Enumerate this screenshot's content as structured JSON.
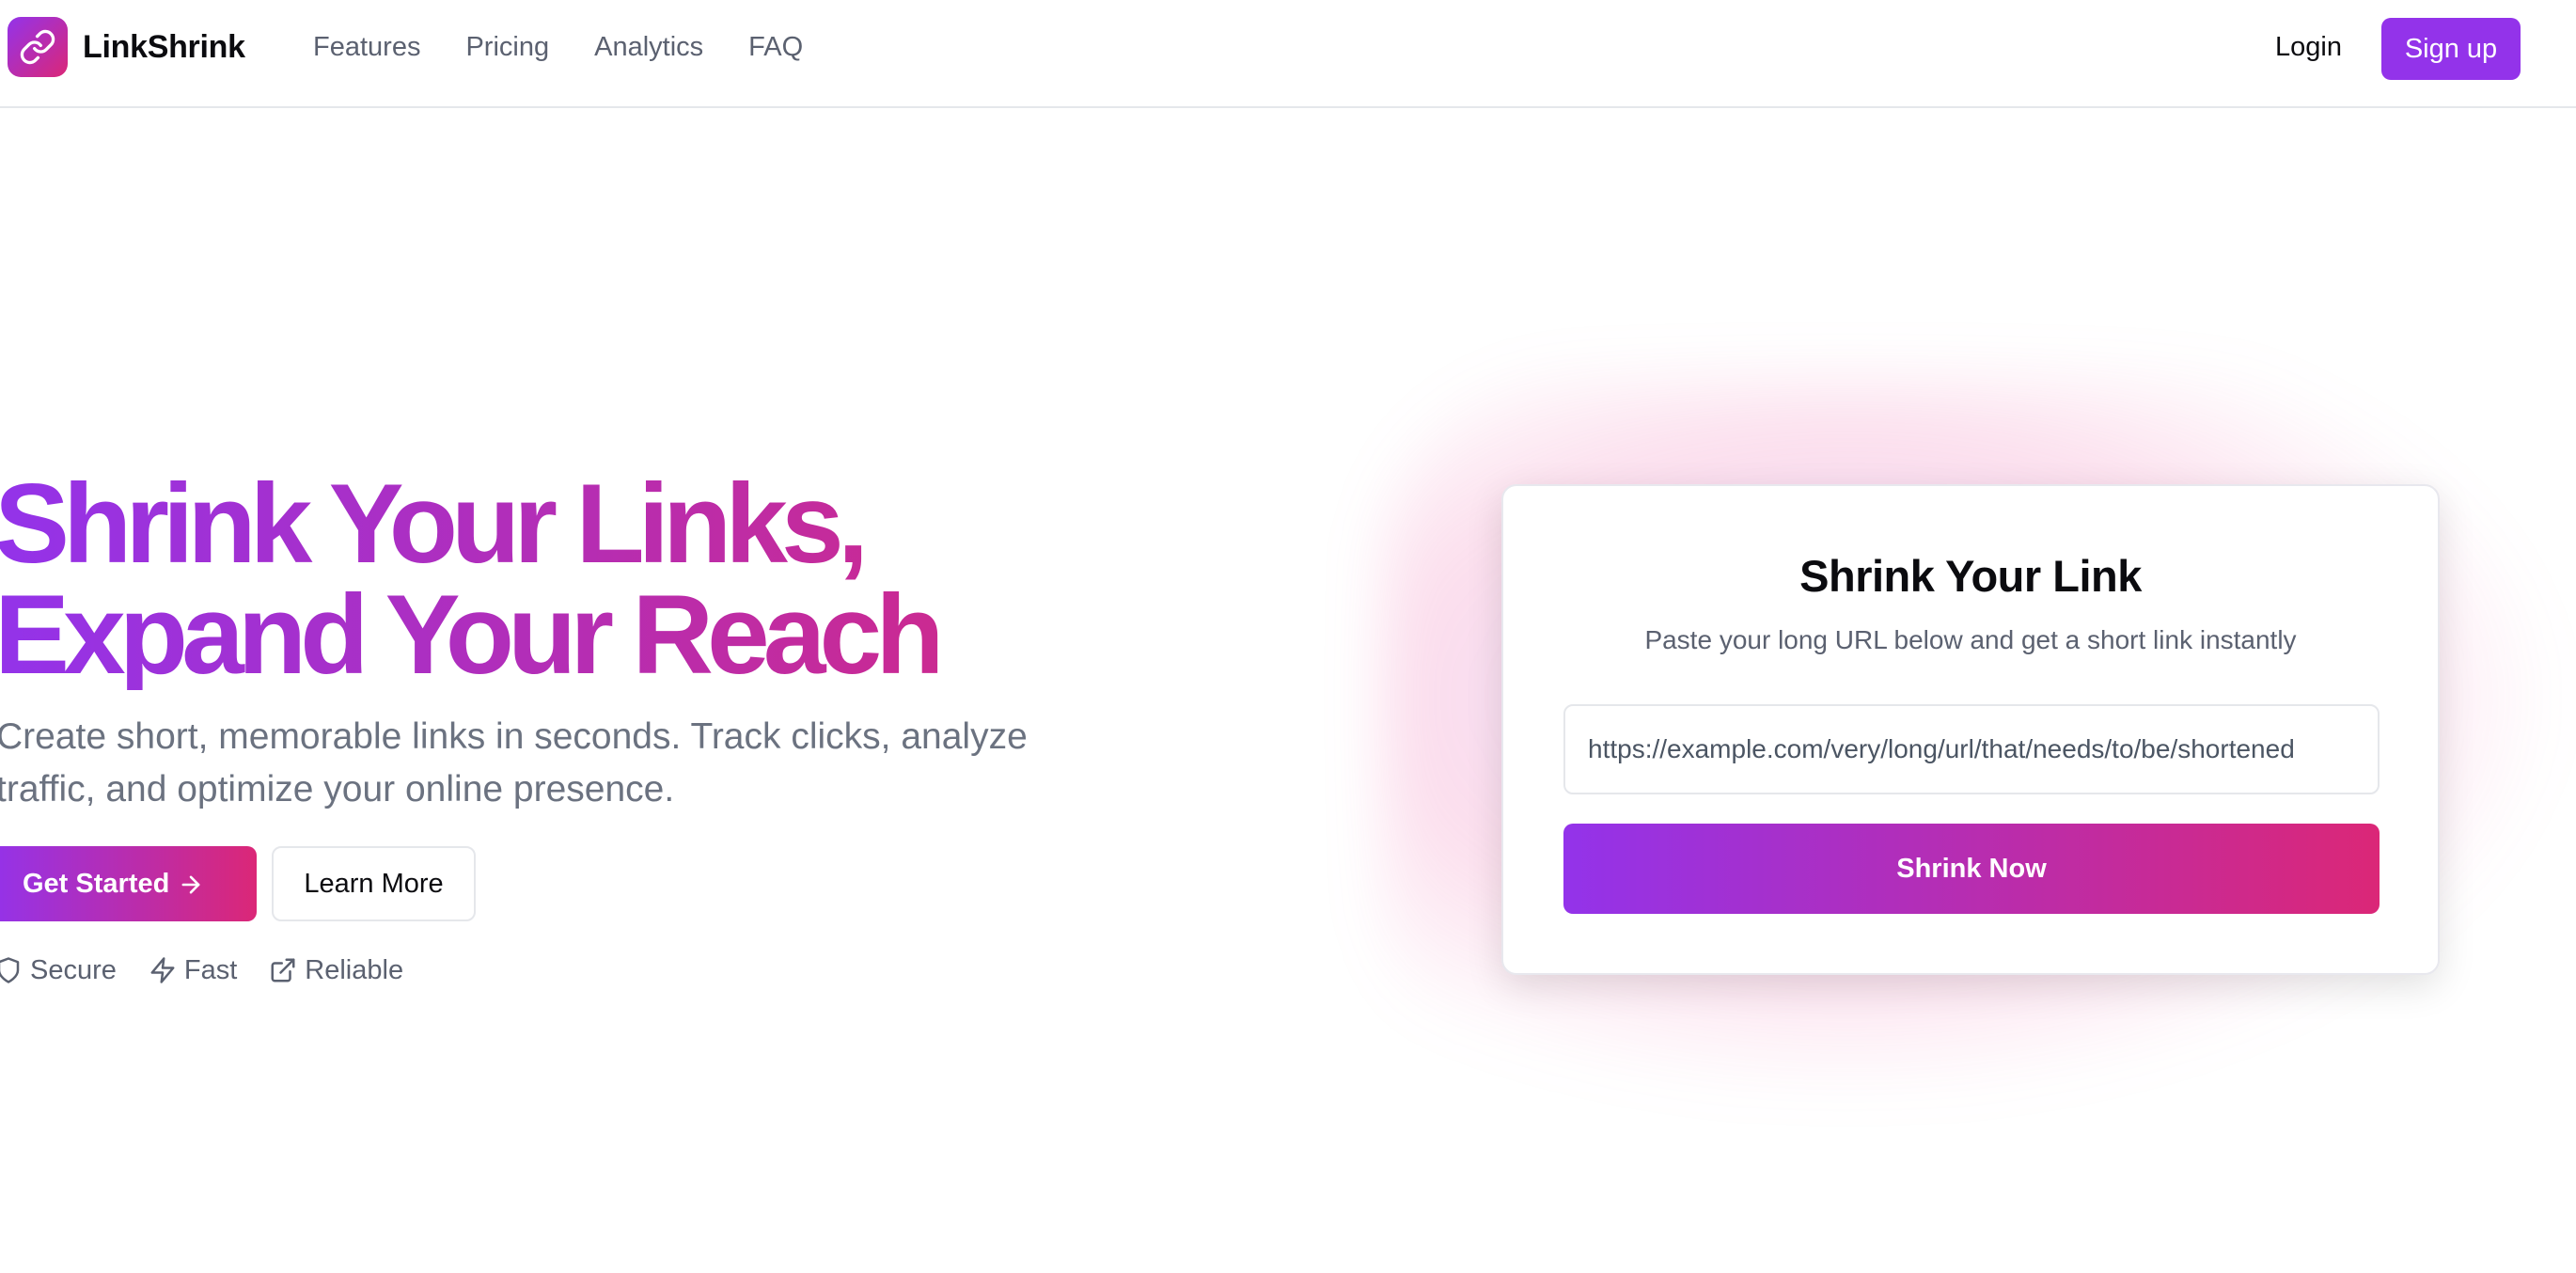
{
  "header": {
    "brand": "LinkShrink",
    "logo_icon": "link-icon",
    "nav": [
      "Features",
      "Pricing",
      "Analytics",
      "FAQ"
    ],
    "login_label": "Login",
    "signup_label": "Sign up"
  },
  "hero": {
    "title": "Shrink Your Links, Expand Your Reach",
    "subtitle": "Create short, memorable links in seconds. Track clicks, analyze traffic, and optimize your online presence.",
    "primary_button": "Get Started",
    "secondary_button": "Learn More",
    "badges": [
      {
        "icon": "shield-icon",
        "label": "Secure"
      },
      {
        "icon": "lightning-icon",
        "label": "Fast"
      },
      {
        "icon": "external-link-icon",
        "label": "Reliable"
      }
    ]
  },
  "card": {
    "title": "Shrink Your Link",
    "subtitle": "Paste your long URL below and get a short link instantly",
    "url_value": "https://example.com/very/long/url/that/needs/to/be/shortened",
    "button_label": "Shrink Now"
  },
  "colors": {
    "purple": "#9333ea",
    "pink": "#db2777"
  }
}
